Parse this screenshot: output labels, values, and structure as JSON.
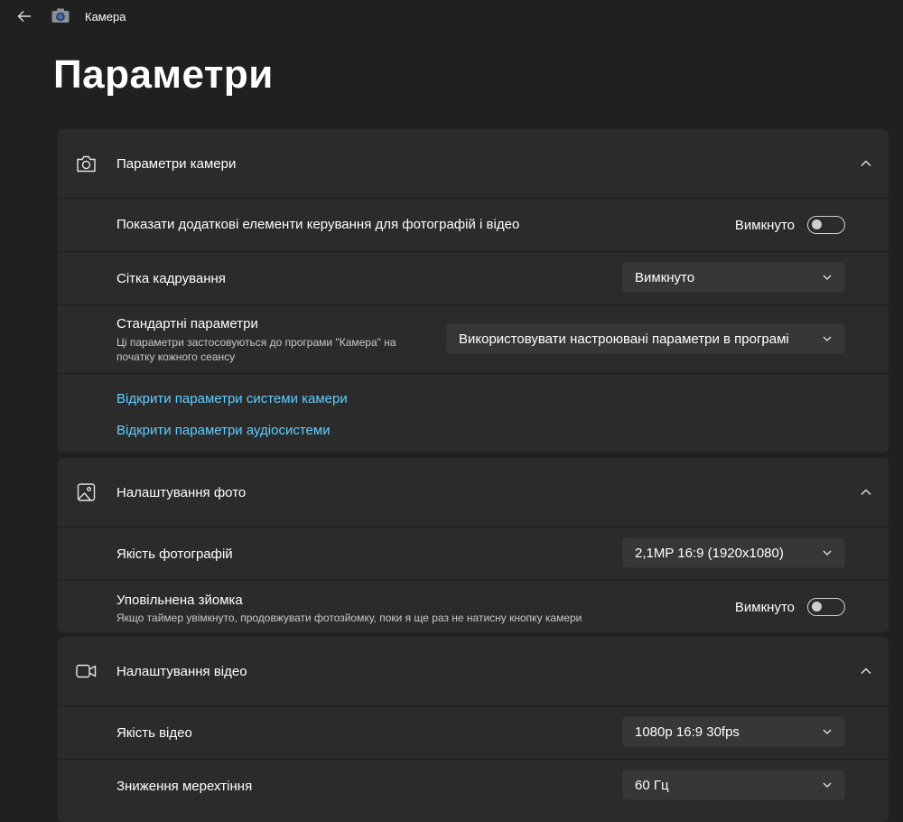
{
  "titlebar": {
    "app_title": "Камера",
    "back_icon": "arrow-left-icon",
    "app_icon": "camera-app-icon"
  },
  "page": {
    "title": "Параметри"
  },
  "colors": {
    "background": "#202020",
    "card": "#2b2b2b",
    "link": "#60cdff",
    "dropdown": "#373737"
  },
  "camera_section": {
    "title": "Параметри камери",
    "icon": "camera-icon",
    "expanded": true,
    "advanced_controls": {
      "label": "Показати додаткові елементи керування для фотографій і відео",
      "state_text": "Вимкнуто",
      "on": false
    },
    "framing_grid": {
      "label": "Сітка кадрування",
      "value": "Вимкнуто"
    },
    "default_settings": {
      "label": "Стандартні параметри",
      "description": "Ці параметри застосовуються до програми \"Камера\" на початку кожного сеансу",
      "value": "Використовувати настроювані параметри в програмі"
    },
    "links": {
      "camera_system": "Відкрити параметри системи камери",
      "audio_system": "Відкрити параметри аудіосистеми"
    }
  },
  "photo_section": {
    "title": "Налаштування фото",
    "icon": "image-icon",
    "expanded": true,
    "photo_quality": {
      "label": "Якість фотографій",
      "value": "2,1MP 16:9 (1920x1080)"
    },
    "time_lapse": {
      "label": "Уповільнена зйомка",
      "description": "Якщо таймер увімкнуто, продовжувати фотозйомку, поки я ще раз не натисну кнопку камери",
      "state_text": "Вимкнуто",
      "on": false
    }
  },
  "video_section": {
    "title": "Налаштування відео",
    "icon": "video-icon",
    "expanded": true,
    "video_quality": {
      "label": "Якість відео",
      "value": "1080p 16:9 30fps"
    },
    "flicker_reduction": {
      "label": "Зниження мерехтіння",
      "value": "60 Гц"
    }
  }
}
